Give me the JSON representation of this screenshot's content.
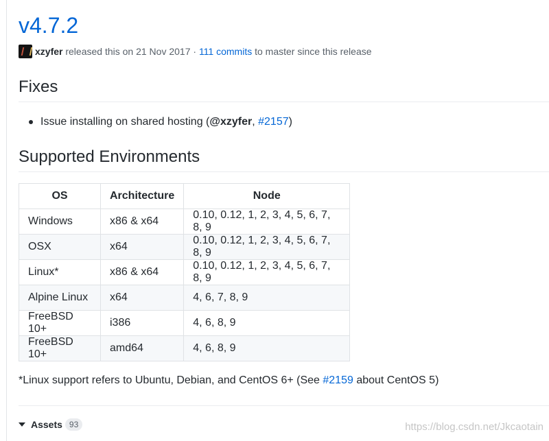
{
  "release": {
    "version": "v4.7.2",
    "author": "xzyfer",
    "released_text": "released this on 21 Nov 2017 ·",
    "commits_link": "111 commits",
    "commits_suffix": "to master since this release"
  },
  "fixes": {
    "heading": "Fixes",
    "items": [
      {
        "prefix": "Issue installing on shared hosting (",
        "mention": "@xzyfer",
        "separator": ", ",
        "issue": "#2157",
        "suffix": ")"
      }
    ]
  },
  "environments": {
    "heading": "Supported Environments",
    "columns": [
      "OS",
      "Architecture",
      "Node"
    ],
    "rows": [
      [
        "Windows",
        "x86 & x64",
        "0.10, 0.12, 1, 2, 3, 4, 5, 6, 7, 8, 9"
      ],
      [
        "OSX",
        "x64",
        "0.10, 0.12, 1, 2, 3, 4, 5, 6, 7, 8, 9"
      ],
      [
        "Linux*",
        "x86 & x64",
        "0.10, 0.12, 1, 2, 3, 4, 5, 6, 7, 8, 9"
      ],
      [
        "Alpine Linux",
        "x64",
        "4, 6, 7, 8, 9"
      ],
      [
        "FreeBSD 10+",
        "i386",
        "4, 6, 8, 9"
      ],
      [
        "FreeBSD 10+",
        "amd64",
        "4, 6, 8, 9"
      ]
    ],
    "footnote": {
      "prefix": "*Linux support refers to Ubuntu, Debian, and CentOS 6+ (See ",
      "link": "#2159",
      "suffix": " about CentOS 5)"
    }
  },
  "assets": {
    "label": "Assets",
    "count": "93"
  },
  "watermark": "https://blog.csdn.net/Jkcaotain"
}
